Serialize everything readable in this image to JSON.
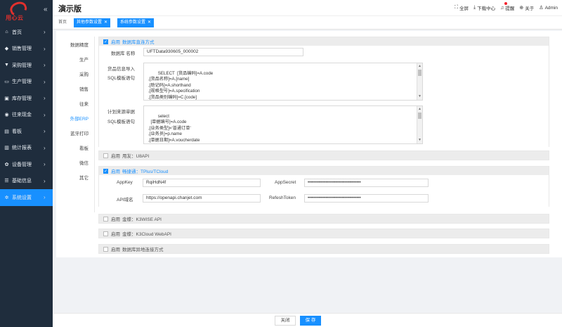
{
  "brand": {
    "logo_text": "用心云",
    "collapse_icon": "double-chevron-left-icon"
  },
  "sidebar": {
    "items": [
      {
        "label": "首页",
        "icon": "home-icon"
      },
      {
        "label": "销售管理",
        "icon": "tag-icon"
      },
      {
        "label": "采购管理",
        "icon": "cart-icon"
      },
      {
        "label": "生产管理",
        "icon": "monitor-icon"
      },
      {
        "label": "库存管理",
        "icon": "box-icon"
      },
      {
        "label": "往来现金",
        "icon": "money-icon"
      },
      {
        "label": "看板",
        "icon": "chart-icon"
      },
      {
        "label": "统计报表",
        "icon": "bar-chart-icon"
      },
      {
        "label": "设备管理",
        "icon": "device-icon"
      },
      {
        "label": "基础信息",
        "icon": "sliders-icon"
      },
      {
        "label": "系统设置",
        "icon": "gear-icon"
      }
    ],
    "active_index": 10
  },
  "header": {
    "title": "演示版",
    "actions": {
      "fullscreen": "全屏",
      "download": "下载中心",
      "alerts": "提醒",
      "about": "关于",
      "user": "Admin"
    }
  },
  "tabs": {
    "home": "首页",
    "items": [
      "其他参数设置",
      "系统参数设置"
    ]
  },
  "subnav": {
    "items": [
      "数据精度",
      "生产",
      "采购",
      "销售",
      "往来",
      "外部ERP",
      "蓝牙打印",
      "看板",
      "微信",
      "其它"
    ],
    "active_index": 5
  },
  "db_direct": {
    "enabled": true,
    "label_prefix": "启用",
    "label": "数据库直连方式",
    "db_name_label": "数据库 名称",
    "db_name_value": "UFTData930605_000002",
    "goods_label_1": "货品信息导入",
    "goods_label_2": "SQL模板语句",
    "goods_sql": "SELECT  [货品编码]=A.code\n,[货品名称]=A.[name]\n,[助记码]=A.shorthand\n,[规格型号]=A.specification\n,[货品类别编码]=C.[code]",
    "plan_label_1": "计划来源单据",
    "plan_label_2": "SQL模板语句",
    "plan_sql": "select\n  [单据编号]=A.code\n,[业务类型]='普通订单'\n,[业务员]=p.name\n,[单据日期]=A.voucherdate"
  },
  "u8": {
    "enabled": false,
    "label_prefix": "启用",
    "label": "用友：U8API"
  },
  "tplus": {
    "enabled": true,
    "label_prefix": "启用",
    "label": "畅捷通：TPlus/TCloud",
    "appkey_label": "AppKey",
    "appkey_value": "RqiHdN4f",
    "appsecret_label": "AppSecret",
    "appsecret_value": "••••••••••••••••••••••••••••••••••••",
    "domain_label": "API域名",
    "domain_value": "https://openapi.chanjet.com",
    "token_label": "RefeshToken",
    "token_value": "••••••••••••••••••••••••••••••••••••"
  },
  "k3wise": {
    "enabled": false,
    "label_prefix": "启用",
    "label": "金蝶：K3WISE API"
  },
  "k3cloud": {
    "enabled": false,
    "label_prefix": "启用",
    "label": "金蝶：K3Cloud WebAPI"
  },
  "remote_db": {
    "enabled": false,
    "label_prefix": "启用",
    "label": "数据库异地连接方式"
  },
  "footer": {
    "close_label": "关闭",
    "save_label": "保 存"
  }
}
